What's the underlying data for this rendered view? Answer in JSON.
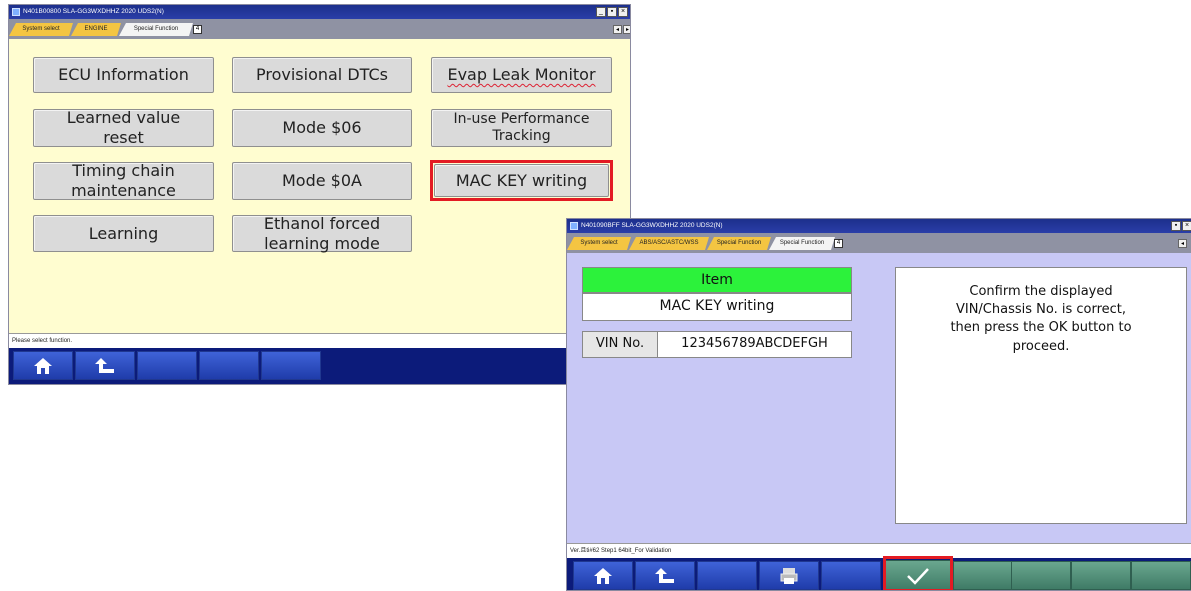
{
  "window1": {
    "title": "N401B00800  SLA-GG3WXDHHZ 2020   UDS2(N)",
    "tabs": [
      "System select",
      "ENGINE",
      "Special Function"
    ],
    "tab_count": "4",
    "nav_left": "◂",
    "nav_right": "▸",
    "functions": [
      "ECU Information",
      "Provisional DTCs",
      "Evap Leak Monitor",
      "Learned value reset",
      "Mode $06",
      "In-use Performance Tracking",
      "Timing chain maintenance",
      "Mode $0A",
      "MAC KEY writing",
      "Learning",
      "Ethanol forced learning mode"
    ],
    "status": "Please select function.",
    "toolbar_icons": [
      "home-icon",
      "back-icon"
    ]
  },
  "window2": {
    "title": "N401090BFF  SLA-GG3WXDHHZ 2020   UDS2(N)",
    "tabs": [
      "System select",
      "ABS/ASC/ASTC/WSS",
      "Special Function",
      "Special Function"
    ],
    "tab_count": "4",
    "item_header": "Item",
    "item_value": "MAC KEY writing",
    "vin_label": "VIN No.",
    "vin_value": "123456789ABCDEFGH",
    "message": "Confirm the displayed VIN/Chassis No. is correct, then press the OK button to proceed.",
    "status": "Ver.且ti#62 Step1 64bit_For Validation",
    "toolbar_icons": [
      "home-icon",
      "back-icon",
      "print-icon",
      "ok-check-icon"
    ]
  },
  "colors": {
    "panel_yellow": "#fffdd0",
    "panel_lavender": "#c8c8f5",
    "title_blue": "#1c2f8c",
    "toolbar_blue": "#0c1b7a",
    "item_green": "#2cf23b",
    "highlight_red": "#e31b23",
    "tab_yellow": "#f4c542"
  }
}
